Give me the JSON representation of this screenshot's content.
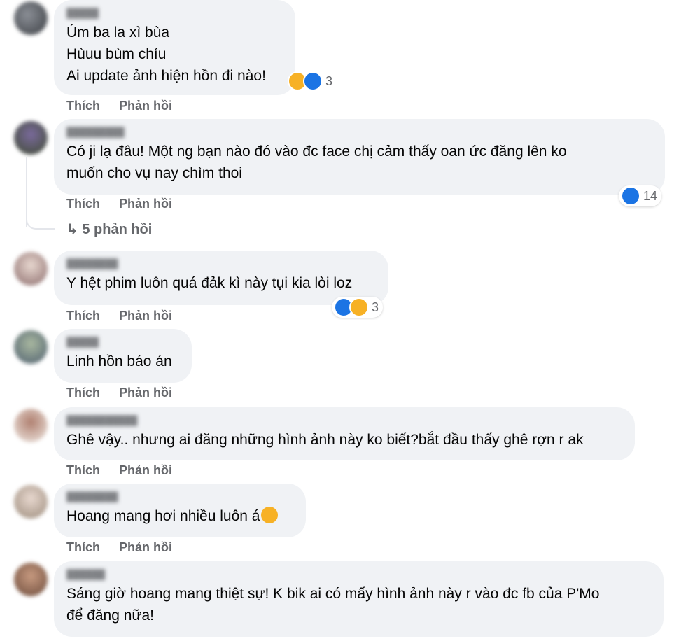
{
  "actions": {
    "like": "Thích",
    "reply": "Phản hồi"
  },
  "comments": [
    {
      "lines": [
        "Úm ba la xì bùa",
        "Hùuu bùm chíu",
        "Ai update ảnh hiện hồn đi nào!"
      ],
      "reaction_count": "3",
      "reaction_icons": [
        "sad-icon",
        "like-icon"
      ]
    },
    {
      "lines": [
        "Có ji lạ đâu! Một ng bạn nào đó vào đc face chị cảm thấy oan ức đăng lên ko",
        "muốn cho vụ nay chìm thoi"
      ],
      "reaction_count": "14",
      "reaction_icons": [
        "like-icon"
      ],
      "replies_label": "5 phản hồi"
    },
    {
      "lines": [
        "Y hệt phim luôn quá đảk kì này tụi kia lòi loz"
      ],
      "reaction_count": "3",
      "reaction_icons": [
        "like-icon",
        "sad-icon"
      ]
    },
    {
      "lines": [
        "Linh hồn báo án"
      ]
    },
    {
      "lines": [
        "Ghê vậy.. nhưng ai đăng những hình ảnh này ko biết?bắt đầu thấy ghê rợn r ak"
      ]
    },
    {
      "lines": [
        "Hoang mang hơi nhiều luôn á"
      ],
      "inline_emoji": "pleading-face-icon"
    },
    {
      "lines": [
        "Sáng giờ hoang mang thiệt sự! K bik ai có mấy hình ảnh này r vào đc fb của P'Mo",
        "để đăng nữa!"
      ]
    }
  ],
  "colors": {
    "bubble": "#f0f2f5",
    "muted": "#65676b",
    "like_blue": "#1b74e4",
    "emoji_yellow": "#f7b125"
  }
}
